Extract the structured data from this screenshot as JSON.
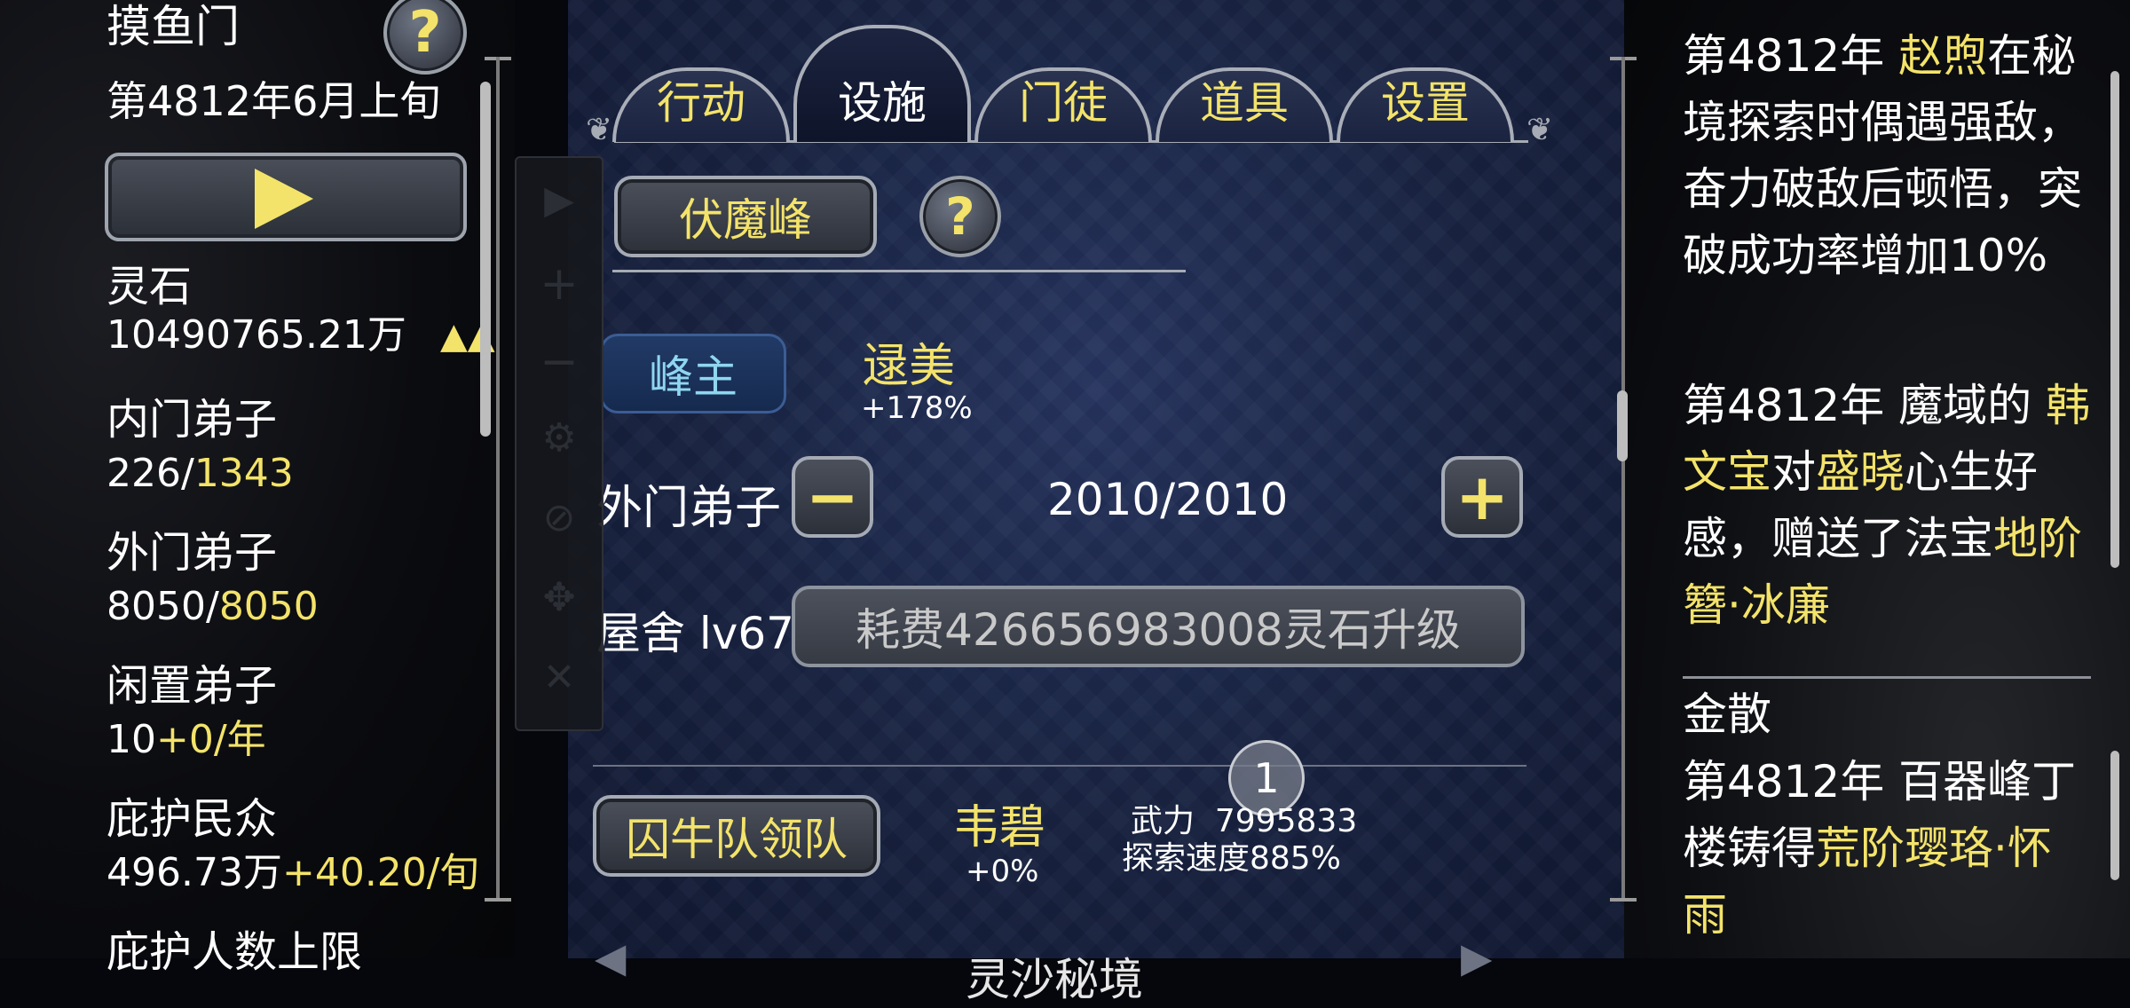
{
  "left": {
    "sect_name": "摸鱼门",
    "date": "第4812年6月上旬",
    "help_icon": "?",
    "play_icon": "play-icon",
    "stats": [
      {
        "label": "灵石",
        "value": "10490765.21万",
        "extra": "▲▲"
      },
      {
        "label": "内门弟子",
        "value_a": "226/",
        "value_b": "1343"
      },
      {
        "label": "外门弟子",
        "value_a": "8050/",
        "value_b": "8050"
      },
      {
        "label": "闲置弟子",
        "value_a": "10",
        "value_b": "+0/年"
      },
      {
        "label": "庇护民众",
        "value_a": "496.73万",
        "value_b": "+40.20/旬"
      },
      {
        "label": "庇护人数上限"
      }
    ]
  },
  "toolbar": [
    "play",
    "plus",
    "minus",
    "gear",
    "eye-off",
    "move",
    "close"
  ],
  "tabs": [
    {
      "label": "行动",
      "active": false
    },
    {
      "label": "设施",
      "active": true
    },
    {
      "label": "门徒",
      "active": false
    },
    {
      "label": "道具",
      "active": false
    },
    {
      "label": "设置",
      "active": false
    }
  ],
  "center": {
    "peak_button": "伏魔峰",
    "help_icon": "?",
    "master_button": "峰主",
    "master_name": "逯美",
    "master_bonus": "+178%",
    "outer_label": "外门弟子",
    "outer_minus": "−",
    "outer_value": "2010/2010",
    "outer_plus": "+",
    "house_label": "屋舍 lv67",
    "house_upgrade": "耗费426656983008灵石升级",
    "team_button": "囚牛队领队",
    "team_leader": "韦碧",
    "team_bonus": "+0%",
    "team_power": "武力  7995833",
    "team_speed": "探索速度885%",
    "badge": "1",
    "bottom_partial": "灵沙秘境"
  },
  "log": [
    {
      "parts": [
        {
          "t": "第4812年 ",
          "c": "white"
        },
        {
          "t": "赵煦",
          "c": "yellow"
        },
        {
          "t": "在秘境探索时偶遇强敌，奋力破敌后顿悟，突破成功率增加10%",
          "c": "white"
        }
      ]
    },
    {
      "parts": [
        {
          "t": "第4812年 魔域的 ",
          "c": "white"
        },
        {
          "t": "韩文宝",
          "c": "yellow"
        },
        {
          "t": "对",
          "c": "white"
        },
        {
          "t": "盛晓",
          "c": "yellow"
        },
        {
          "t": "心生好感，赠送了法宝",
          "c": "white"
        },
        {
          "t": "地阶簪·冰廉",
          "c": "yellow"
        }
      ]
    },
    {
      "parts": [
        {
          "t": "金散",
          "c": "white"
        }
      ]
    },
    {
      "parts": [
        {
          "t": "第4812年 百器峰丁楼铸得",
          "c": "white"
        },
        {
          "t": "荒阶璎珞·怀雨",
          "c": "yellow"
        }
      ]
    }
  ],
  "colors": {
    "accent_yellow": "#f3e36a",
    "light_blue": "#8fd6f0",
    "panel_blue": "#1a2646"
  }
}
